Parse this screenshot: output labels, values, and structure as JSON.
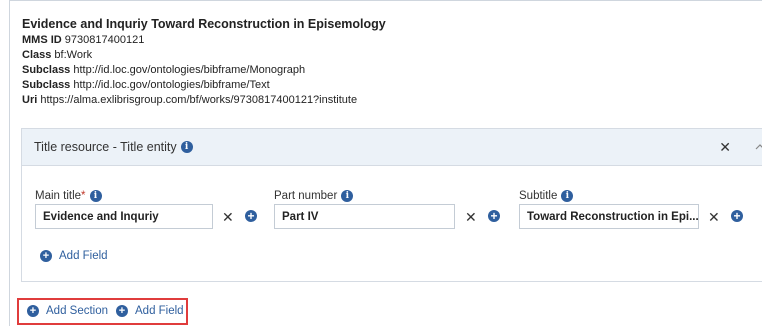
{
  "header": {
    "title": "Evidence and Inquriy Toward Reconstruction in Episemology",
    "mms_label": "MMS ID",
    "mms_value": "9730817400121",
    "class_label": "Class",
    "class_value": "bf:Work",
    "subclass1_label": "Subclass",
    "subclass1_value": "http://id.loc.gov/ontologies/bibframe/Monograph",
    "subclass2_label": "Subclass",
    "subclass2_value": "http://id.loc.gov/ontologies/bibframe/Text",
    "uri_label": "Uri",
    "uri_value": "https://alma.exlibrisgroup.com/bf/works/9730817400121?institute"
  },
  "section": {
    "title": "Title resource - Title entity",
    "close_icon": "close-icon",
    "collapse_icon": "chevron-up-icon"
  },
  "fields": {
    "main_title": {
      "label": "Main title",
      "required_mark": "*",
      "value": "Evidence and Inquriy"
    },
    "part_number": {
      "label": "Part number",
      "value": "Part IV"
    },
    "subtitle": {
      "label": "Subtitle",
      "value": "Toward Reconstruction in Epi..."
    }
  },
  "section_add_field": "Add Field",
  "footer": {
    "add_section": "Add Section",
    "add_field": "Add Field"
  },
  "colors": {
    "accent": "#2f5f9e",
    "highlight": "#e03c3c",
    "section_header_bg": "#ecf2f8"
  }
}
